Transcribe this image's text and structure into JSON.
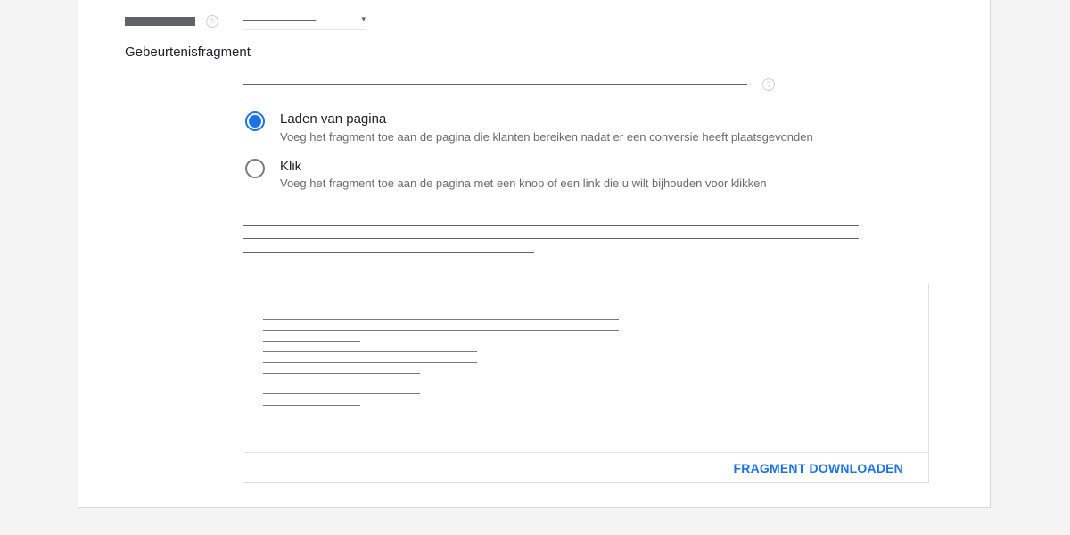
{
  "form": {
    "field_help_icon": "question-icon",
    "select_arrow": "▾"
  },
  "event_snippet": {
    "title": "Gebeurtenisfragment",
    "help_icon": "question-icon",
    "options": [
      {
        "label": "Laden van pagina",
        "description": "Voeg het fragment toe aan de pagina die klanten bereiken nadat er een conversie heeft plaatsgevonden",
        "selected": true
      },
      {
        "label": "Klik",
        "description": "Voeg het fragment toe aan de pagina met een knop of een link die u wilt bijhouden voor klikken",
        "selected": false
      }
    ]
  },
  "code_box": {
    "download_label": "FRAGMENT DOWNLOADEN"
  },
  "colors": {
    "accent": "#1a73e8",
    "text": "#202124",
    "muted": "#6b6b6b"
  }
}
